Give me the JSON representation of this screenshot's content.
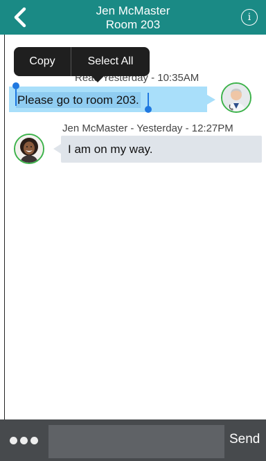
{
  "header": {
    "back_icon": "chevron-left-icon",
    "title": "Jen McMaster",
    "subtitle": "Room 203",
    "info_label": "i"
  },
  "context_menu": {
    "copy": "Copy",
    "select_all": "Select All"
  },
  "messages": [
    {
      "direction": "outgoing",
      "meta": "Read Yesterday - 10:35AM",
      "text": "Please go to room 203."
    },
    {
      "direction": "incoming",
      "meta": "Jen McMaster - Yesterday - 12:27PM",
      "text": "I am on my way."
    }
  ],
  "composer": {
    "more_icon": "more-dots-icon",
    "input_value": "",
    "send_label": "Send"
  },
  "colors": {
    "header_bg": "#1a8a85",
    "outgoing_bubble": "#a9dffa",
    "incoming_bubble": "#dfe4ea",
    "composer_bg": "#474a4d",
    "avatar_ring": "#3cb24a",
    "selection_handle": "#1f78e0"
  }
}
